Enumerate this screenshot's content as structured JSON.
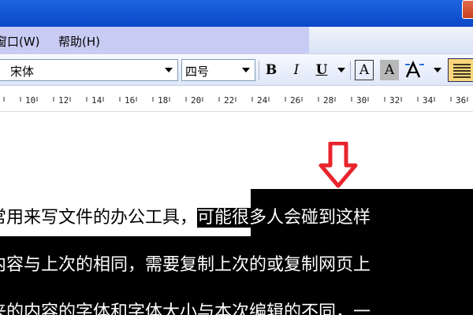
{
  "menubar": {
    "items": [
      "窗口(W)",
      "帮助(H)"
    ]
  },
  "toolbar": {
    "font_name": "宋体",
    "font_size": "四号",
    "bold_label": "B",
    "italic_label": "I",
    "underline_label": "U",
    "border_char_label": "A",
    "shade_char_label": "A"
  },
  "ruler": {
    "ticks": [
      "10",
      "12",
      "14",
      "16",
      "18",
      "20",
      "22",
      "24",
      "26",
      "28",
      "30",
      "32",
      "34",
      "36"
    ]
  },
  "document": {
    "line1_plain": "常用来写文件的办公工具，",
    "line1_selected": "可能很多人会碰到这样",
    "line2_selected": "内容与上次的相同，需要复制上次的或复制网页上",
    "line3_selected": "来的内容的字体和字体大小与本次编辑的不同，一"
  },
  "annotation": {
    "arrow_color": "#e8242c"
  },
  "colors": {
    "titlebar": "#1c64e0",
    "selection": "#000000"
  }
}
